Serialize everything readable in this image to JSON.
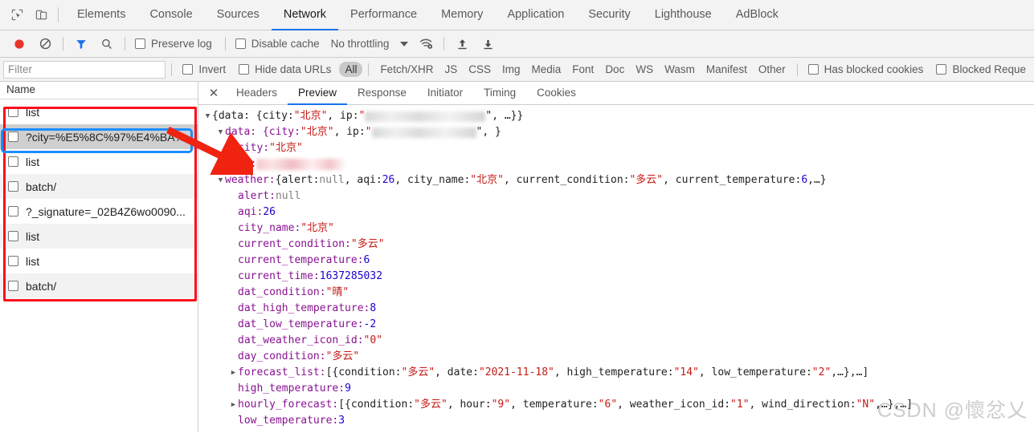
{
  "devtools": {
    "left_icons": [
      {
        "name": "inspect-element-icon",
        "label": "Inspect element"
      },
      {
        "name": "device-toolbar-icon",
        "label": "Toggle device toolbar"
      }
    ],
    "tabs": [
      {
        "label": "Elements",
        "active": false
      },
      {
        "label": "Console",
        "active": false
      },
      {
        "label": "Sources",
        "active": false
      },
      {
        "label": "Network",
        "active": true
      },
      {
        "label": "Performance",
        "active": false
      },
      {
        "label": "Memory",
        "active": false
      },
      {
        "label": "Application",
        "active": false
      },
      {
        "label": "Security",
        "active": false
      },
      {
        "label": "Lighthouse",
        "active": false
      },
      {
        "label": "AdBlock",
        "active": false
      }
    ]
  },
  "control_bar": {
    "record_icon": "record-button-icon",
    "clear_icon": "clear-icon",
    "filter_icon": "filter-funnel-icon",
    "search_icon": "search-icon",
    "preserve_log_label": "Preserve log",
    "disable_cache_label": "Disable cache",
    "throttling_value": "No throttling",
    "throttling_caret": "chevron-down-icon",
    "wifi_settings_icon": "wifi-gear-icon",
    "import_icon": "import-har-icon",
    "export_icon": "export-har-icon"
  },
  "filter_bar": {
    "filter_placeholder": "Filter",
    "filter_value": "",
    "invert_label": "Invert",
    "hide_data_urls_label": "Hide data URLs",
    "types": [
      {
        "label": "All",
        "active": true
      },
      {
        "label": "Fetch/XHR",
        "active": false
      },
      {
        "label": "JS",
        "active": false
      },
      {
        "label": "CSS",
        "active": false
      },
      {
        "label": "Img",
        "active": false
      },
      {
        "label": "Media",
        "active": false
      },
      {
        "label": "Font",
        "active": false
      },
      {
        "label": "Doc",
        "active": false
      },
      {
        "label": "WS",
        "active": false
      },
      {
        "label": "Wasm",
        "active": false
      },
      {
        "label": "Manifest",
        "active": false
      },
      {
        "label": "Other",
        "active": false
      }
    ],
    "has_blocked_cookies_label": "Has blocked cookies",
    "blocked_requests_label": "Blocked Reque"
  },
  "request_list": {
    "column_header": "Name",
    "rows": [
      {
        "name": "list",
        "selected": false
      },
      {
        "name": "?city=%E5%8C%97%E4%BA%.",
        "selected": true
      },
      {
        "name": "list",
        "selected": false
      },
      {
        "name": "batch/",
        "selected": false
      },
      {
        "name": "?_signature=_02B4Z6wo0090...",
        "selected": false
      },
      {
        "name": "list",
        "selected": false
      },
      {
        "name": "list",
        "selected": false
      },
      {
        "name": "batch/",
        "selected": false
      }
    ]
  },
  "detail_panel": {
    "close_icon": "close-icon",
    "tabs": [
      {
        "label": "Headers",
        "active": false
      },
      {
        "label": "Preview",
        "active": true
      },
      {
        "label": "Response",
        "active": false
      },
      {
        "label": "Initiator",
        "active": false
      },
      {
        "label": "Timing",
        "active": false
      },
      {
        "label": "Cookies",
        "active": false
      }
    ]
  },
  "preview_json": {
    "lines": [
      {
        "indent": 0,
        "arrow": "down",
        "parts": [
          {
            "t": "{data: {city: ",
            "c": "p"
          },
          {
            "t": "\"北京\"",
            "c": "s"
          },
          {
            "t": ", ip: ",
            "c": "p"
          },
          {
            "t": "\"",
            "c": "s"
          },
          {
            "t": "BLUR_GRAY_150",
            "c": "blur"
          },
          {
            "t": "\", …}}",
            "c": "p"
          }
        ]
      },
      {
        "indent": 1,
        "arrow": "down",
        "parts": [
          {
            "t": "data: {city: ",
            "c": "k"
          },
          {
            "t": "\"北京\"",
            "c": "s"
          },
          {
            "t": ", ip: ",
            "c": "p"
          },
          {
            "t": "\"",
            "c": "s"
          },
          {
            "t": "BLUR_GRAY_130",
            "c": "blur"
          },
          {
            "t": "\", }",
            "c": "p"
          }
        ]
      },
      {
        "indent": 2,
        "arrow": "none",
        "parts": [
          {
            "t": "city: ",
            "c": "k"
          },
          {
            "t": "\"北京\"",
            "c": "s"
          }
        ]
      },
      {
        "indent": 2,
        "arrow": "none",
        "parts": [
          {
            "t": "ip: ",
            "c": "k"
          },
          {
            "t": "BLUR_PINK_112",
            "c": "blurpink"
          }
        ]
      },
      {
        "indent": 1,
        "arrow": "down",
        "parts": [
          {
            "t": "weather: ",
            "c": "k"
          },
          {
            "t": "{alert: ",
            "c": "p"
          },
          {
            "t": "null",
            "c": "nul"
          },
          {
            "t": ", aqi: ",
            "c": "p"
          },
          {
            "t": "26",
            "c": "n"
          },
          {
            "t": ", city_name: ",
            "c": "p"
          },
          {
            "t": "\"北京\"",
            "c": "s"
          },
          {
            "t": ", current_condition: ",
            "c": "p"
          },
          {
            "t": "\"多云\"",
            "c": "s"
          },
          {
            "t": ", current_temperature: ",
            "c": "p"
          },
          {
            "t": "6",
            "c": "n"
          },
          {
            "t": ",…}",
            "c": "p"
          }
        ]
      },
      {
        "indent": 2,
        "arrow": "none",
        "parts": [
          {
            "t": "alert: ",
            "c": "k"
          },
          {
            "t": "null",
            "c": "nul"
          }
        ]
      },
      {
        "indent": 2,
        "arrow": "none",
        "parts": [
          {
            "t": "aqi: ",
            "c": "k"
          },
          {
            "t": "26",
            "c": "n"
          }
        ]
      },
      {
        "indent": 2,
        "arrow": "none",
        "parts": [
          {
            "t": "city_name: ",
            "c": "k"
          },
          {
            "t": "\"北京\"",
            "c": "s"
          }
        ]
      },
      {
        "indent": 2,
        "arrow": "none",
        "parts": [
          {
            "t": "current_condition: ",
            "c": "k"
          },
          {
            "t": "\"多云\"",
            "c": "s"
          }
        ]
      },
      {
        "indent": 2,
        "arrow": "none",
        "parts": [
          {
            "t": "current_temperature: ",
            "c": "k"
          },
          {
            "t": "6",
            "c": "n"
          }
        ]
      },
      {
        "indent": 2,
        "arrow": "none",
        "parts": [
          {
            "t": "current_time: ",
            "c": "k"
          },
          {
            "t": "1637285032",
            "c": "n"
          }
        ]
      },
      {
        "indent": 2,
        "arrow": "none",
        "parts": [
          {
            "t": "dat_condition: ",
            "c": "k"
          },
          {
            "t": "\"晴\"",
            "c": "s"
          }
        ]
      },
      {
        "indent": 2,
        "arrow": "none",
        "parts": [
          {
            "t": "dat_high_temperature: ",
            "c": "k"
          },
          {
            "t": "8",
            "c": "n"
          }
        ]
      },
      {
        "indent": 2,
        "arrow": "none",
        "parts": [
          {
            "t": "dat_low_temperature: ",
            "c": "k"
          },
          {
            "t": "-2",
            "c": "n"
          }
        ]
      },
      {
        "indent": 2,
        "arrow": "none",
        "parts": [
          {
            "t": "dat_weather_icon_id: ",
            "c": "k"
          },
          {
            "t": "\"0\"",
            "c": "s"
          }
        ]
      },
      {
        "indent": 2,
        "arrow": "none",
        "parts": [
          {
            "t": "day_condition: ",
            "c": "k"
          },
          {
            "t": "\"多云\"",
            "c": "s"
          }
        ]
      },
      {
        "indent": 2,
        "arrow": "right",
        "parts": [
          {
            "t": "forecast_list: ",
            "c": "k"
          },
          {
            "t": "[{condition: ",
            "c": "p"
          },
          {
            "t": "\"多云\"",
            "c": "s"
          },
          {
            "t": ", date: ",
            "c": "p"
          },
          {
            "t": "\"2021-11-18\"",
            "c": "s"
          },
          {
            "t": ", high_temperature: ",
            "c": "p"
          },
          {
            "t": "\"14\"",
            "c": "s"
          },
          {
            "t": ", low_temperature: ",
            "c": "p"
          },
          {
            "t": "\"2\"",
            "c": "s"
          },
          {
            "t": ",…},…]",
            "c": "p"
          }
        ]
      },
      {
        "indent": 2,
        "arrow": "none",
        "parts": [
          {
            "t": "high_temperature: ",
            "c": "k"
          },
          {
            "t": "9",
            "c": "n"
          }
        ]
      },
      {
        "indent": 2,
        "arrow": "right",
        "parts": [
          {
            "t": "hourly_forecast: ",
            "c": "k"
          },
          {
            "t": "[{condition: ",
            "c": "p"
          },
          {
            "t": "\"多云\"",
            "c": "s"
          },
          {
            "t": ", hour: ",
            "c": "p"
          },
          {
            "t": "\"9\"",
            "c": "s"
          },
          {
            "t": ", temperature: ",
            "c": "p"
          },
          {
            "t": "\"6\"",
            "c": "s"
          },
          {
            "t": ", weather_icon_id: ",
            "c": "p"
          },
          {
            "t": "\"1\"",
            "c": "s"
          },
          {
            "t": ", wind_direction: ",
            "c": "p"
          },
          {
            "t": "\"N\"",
            "c": "s"
          },
          {
            "t": ",…},…]",
            "c": "p"
          }
        ]
      },
      {
        "indent": 2,
        "arrow": "none",
        "parts": [
          {
            "t": "low_temperature: ",
            "c": "k"
          },
          {
            "t": "3",
            "c": "n"
          }
        ]
      }
    ]
  },
  "annotations": {
    "red_box_color": "#fc0d1b",
    "blue_box_color": "#1a8cff",
    "arrow_color": "#f02311"
  },
  "watermark": {
    "text": "CSDN @懷忿乂"
  }
}
